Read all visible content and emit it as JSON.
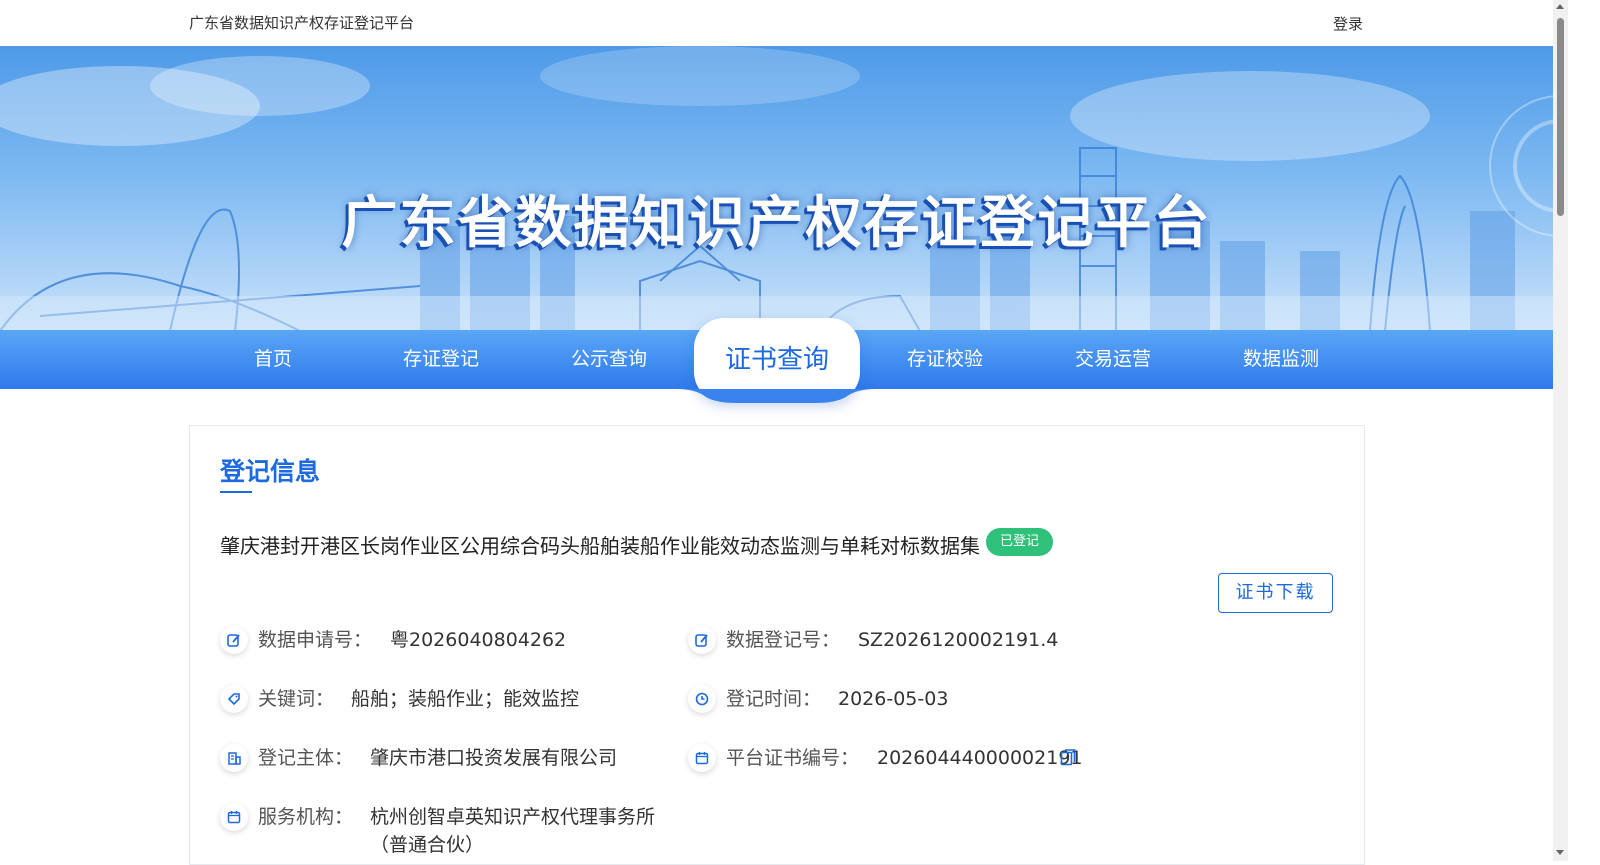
{
  "topbar": {
    "site_name": "广东省数据知识产权存证登记平台",
    "login": "登录"
  },
  "banner": {
    "title": "广东省数据知识产权存证登记平台"
  },
  "nav": {
    "items": [
      {
        "label": "首页",
        "active": false
      },
      {
        "label": "存证登记",
        "active": false
      },
      {
        "label": "公示查询",
        "active": false
      },
      {
        "label": "证书查询",
        "active": true
      },
      {
        "label": "存证校验",
        "active": false
      },
      {
        "label": "交易运营",
        "active": false
      },
      {
        "label": "数据监测",
        "active": false
      }
    ]
  },
  "record": {
    "section_title": "登记信息",
    "name": "肇庆港封开港区长岗作业区公用综合码头船舶装船作业能效动态监测与单耗对标数据集",
    "status": "已登记",
    "download_button": "证书下载",
    "fields": {
      "application_no": {
        "label": "数据申请号：",
        "value": "粤2026040804262"
      },
      "registration_no": {
        "label": "数据登记号：",
        "value": "SZ2026120002191.4"
      },
      "keywords": {
        "label": "关键词：",
        "value": "船舶；装船作业；能效监控"
      },
      "registration_time": {
        "label": "登记时间：",
        "value": "2026-05-03"
      },
      "registrant": {
        "label": "登记主体：",
        "value": "肇庆市港口投资发展有限公司"
      },
      "certificate_no": {
        "label": "平台证书编号：",
        "value": "20260444000002191"
      },
      "service_agency": {
        "label": "服务机构：",
        "value": "杭州创智卓英知识产权代理事务所",
        "value_line2": "（普通合伙）"
      }
    }
  },
  "colors": {
    "accent": "#1d69e0",
    "status_green": "#2fc07a",
    "nav_blue": "#2f79ec"
  }
}
